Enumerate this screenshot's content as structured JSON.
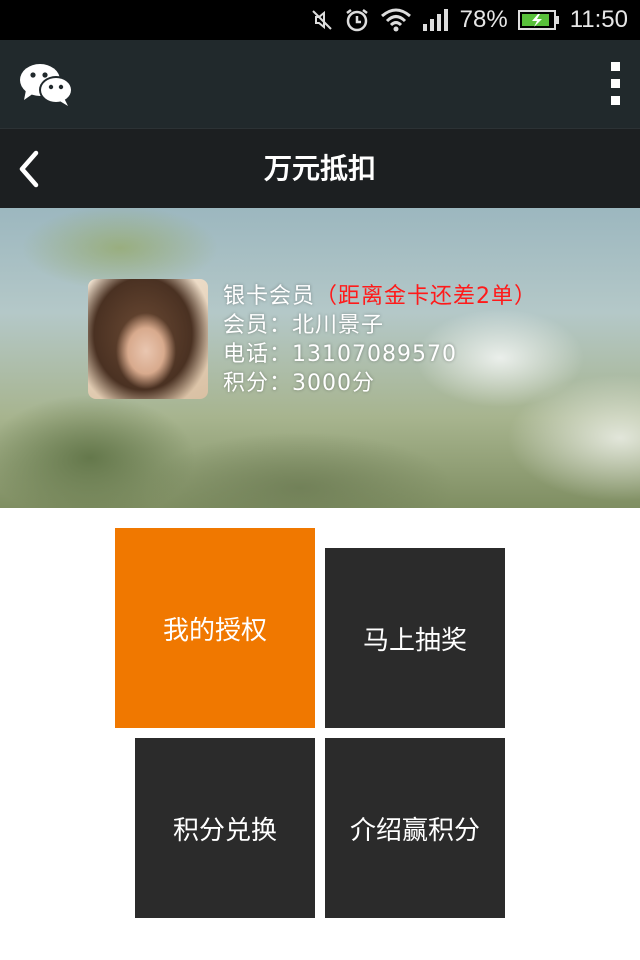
{
  "status_bar": {
    "battery_percent": "78%",
    "time": "11:50",
    "icons": [
      "mute-icon",
      "alarm-icon",
      "wifi-icon",
      "signal-icon",
      "battery-charging-icon"
    ]
  },
  "app_bar": {
    "logo_icon": "wechat-logo-icon",
    "menu_icon": "more-vertical-icon"
  },
  "title_bar": {
    "back_icon": "chevron-left-icon",
    "title": "万元抵扣"
  },
  "member": {
    "level": "银卡会员",
    "upgrade_hint": "（距离金卡还差2单）",
    "name_line": "会员：北川景子",
    "phone_line": "电话：13107089570",
    "points_line": "积分：3000分"
  },
  "menu": {
    "my_authorization": "我的授权",
    "lottery": "马上抽奖",
    "points_exchange": "积分兑换",
    "refer_earn_points": "介绍赢积分"
  },
  "colors": {
    "accent_orange": "#f07800",
    "tile_dark": "#2b2b2b",
    "hint_red": "#ff1a1a"
  }
}
